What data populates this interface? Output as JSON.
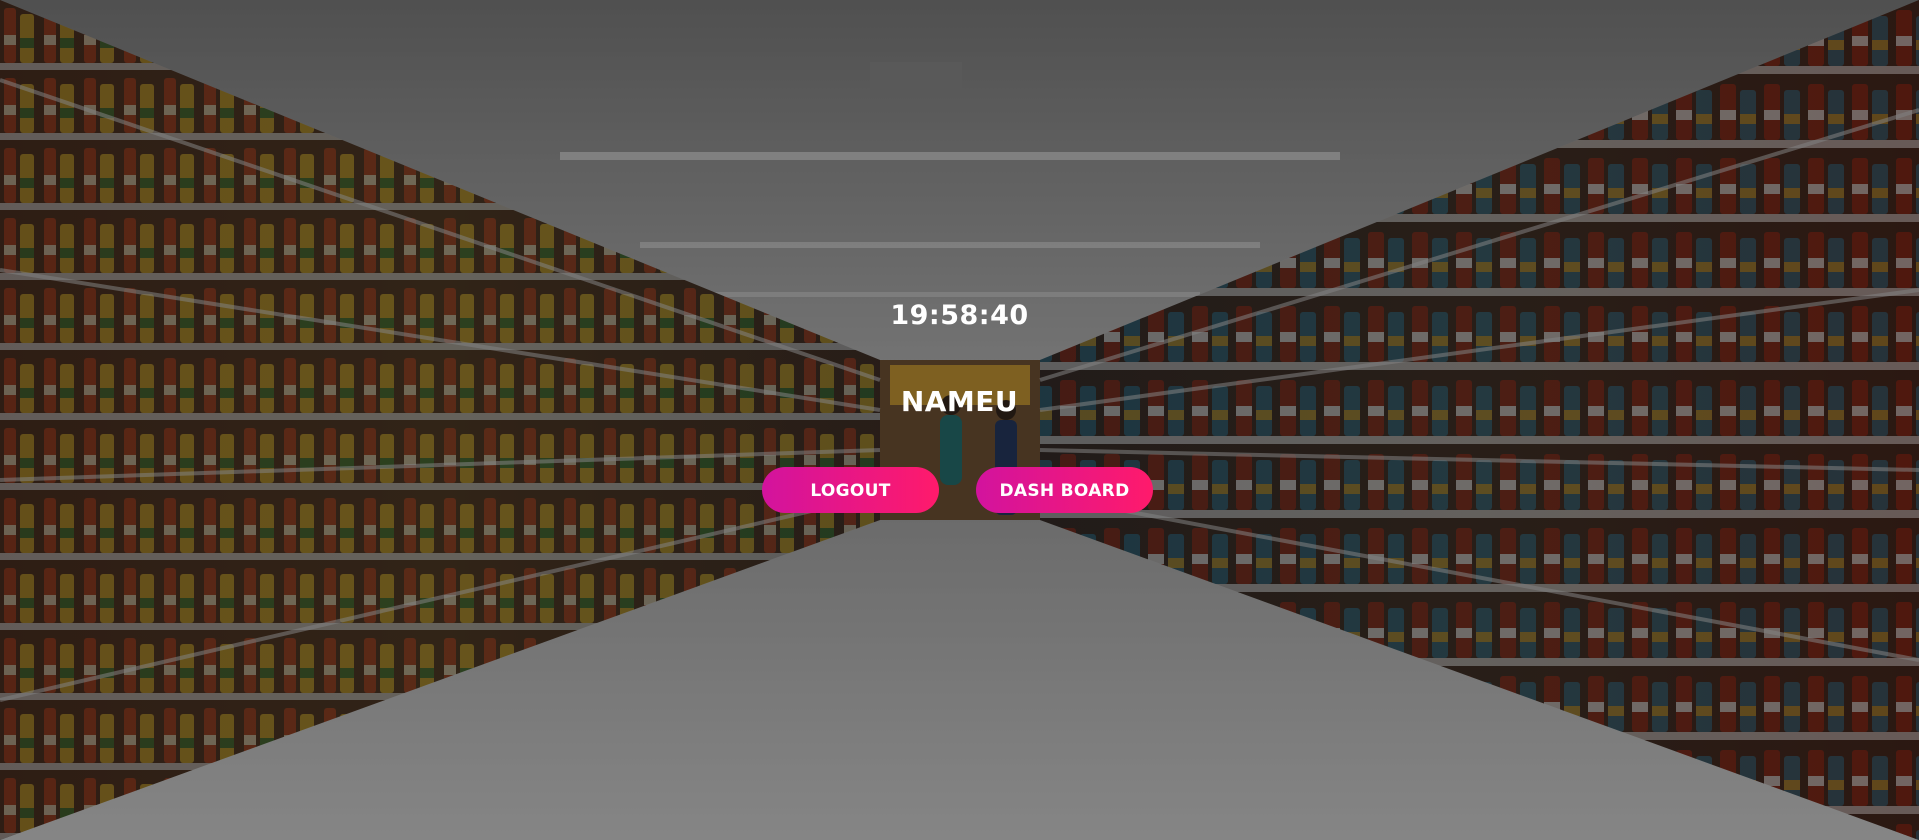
{
  "clock": {
    "time": "19:58:40"
  },
  "user": {
    "name": "NAMEU"
  },
  "actions": {
    "logout_label": "LOGOUT",
    "dashboard_label": "DASH BOARD"
  },
  "colors": {
    "button_gradient_start": "#d2139e",
    "button_gradient_end": "#ff1a6b",
    "text": "#ffffff"
  }
}
